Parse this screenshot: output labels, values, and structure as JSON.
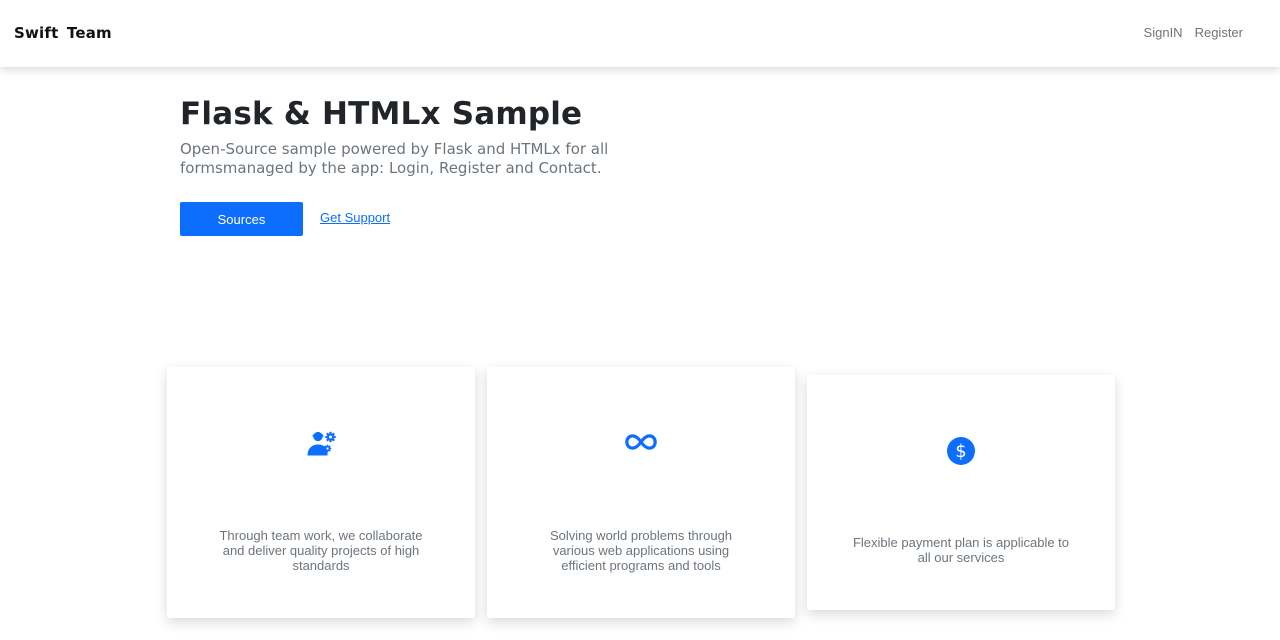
{
  "navbar": {
    "brand": "Swift  Team",
    "links": [
      "SignIN",
      "Register"
    ]
  },
  "hero": {
    "title": "Flask & HTMLx Sample",
    "subtitle": "Open-Source sample powered by Flask and HTMLx for all formsmanaged by the app: Login, Register and Contact.",
    "primary_button": "Sources",
    "secondary_link": "Get Support"
  },
  "features": [
    {
      "icon": "team-gear-icon",
      "text": "Through team work, we collaborate and deliver quality projects of high standards"
    },
    {
      "icon": "infinity-icon",
      "text": "Solving world problems through various web applications using efficient programs and tools"
    },
    {
      "icon": "dollar-coin-icon",
      "text": "Flexible payment plan is applicable to all our services"
    }
  ],
  "colors": {
    "accent": "#0d6efd",
    "muted_text": "#6c757d",
    "heading_text": "#212529"
  }
}
